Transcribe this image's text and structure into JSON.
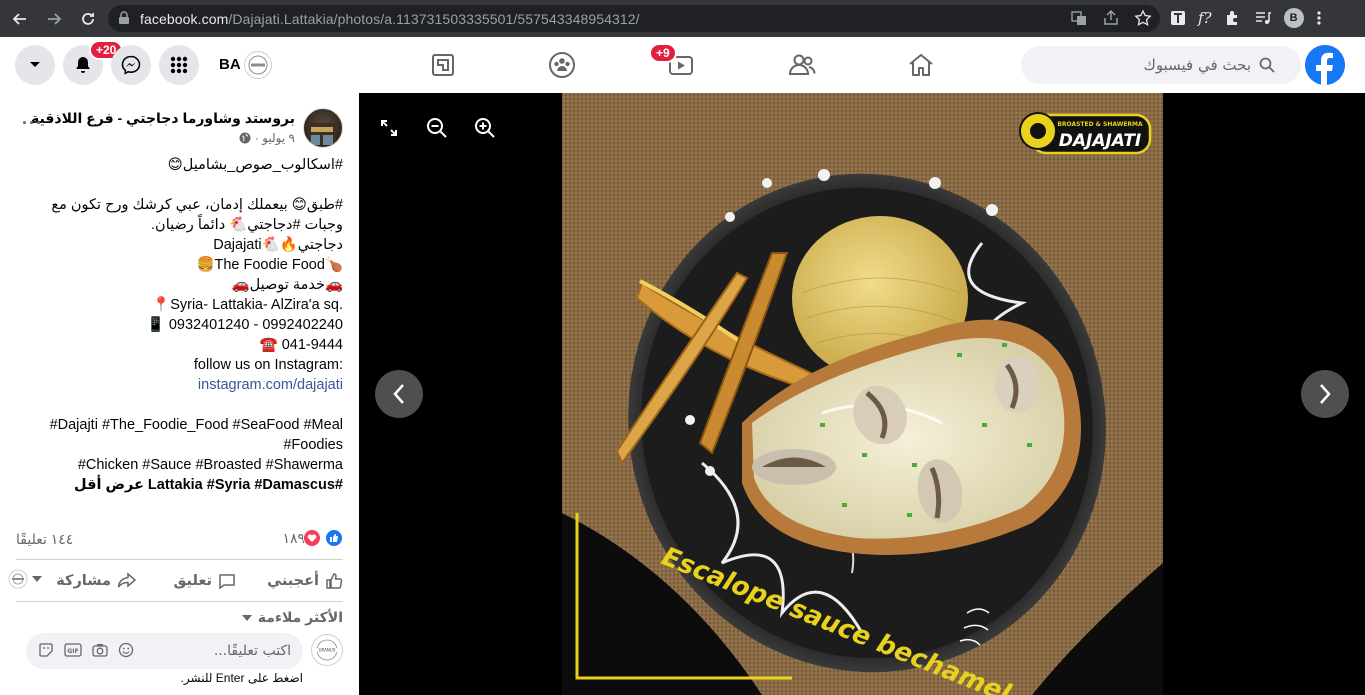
{
  "browser": {
    "url_host": "facebook.com",
    "url_path": "/Dajajati.Lattakia/photos/a.113731503335501/557543348954312/",
    "profile_initial": "B"
  },
  "fb": {
    "search_placeholder": "بحث في فيسبوك",
    "video_badge": "+9",
    "notif_badge": "+20",
    "account_label": "BA",
    "brand_color": "#1877f2"
  },
  "post": {
    "page_name": "بروستد وشاورما دجاجتي - فرع اللاذقية",
    "date": "٩ يوليو ·",
    "lines": [
      "#اسكالوب_صوص_بشاميل😊",
      "",
      "#طبق😊 بيعملك إدمان، عبي كرشك ورح تكون مع",
      "وجبات #دجاجتي🐔 دائماً رضيان.",
      "دجاجتي🔥🐔Dajajati",
      "🍗The Foodie Food🍔",
      "🚗خدمة توصيل🚗",
      "📍Syria- Lattakia- AlZira'a sq.",
      "📱 0932401240 - 0992402240",
      "☎️ 041-9444",
      "follow us on Instagram:",
      "instagram.com/dajajati",
      "",
      "#Dajajti #The_Foodie_Food #SeaFood #Meal",
      "#Foodies",
      "#Chicken #Sauce #Broasted #Shawerma",
      "#Lattakia #Syria #Damascus عرض أقل"
    ],
    "reactions_count": "١٨٩",
    "comments_count": "١٤٤ تعليقًا",
    "like_label": "أعجبني",
    "comment_label": "تعليق",
    "share_label": "مشاركة",
    "relevance_label": "الأكثر ملاءمة",
    "comment_placeholder": "اكتب تعليقًا...",
    "comment_hint": "اضغط على Enter للنشر.",
    "commenter_avatar_text": "URANUS"
  },
  "photo": {
    "logo_text": "DAJAJATI",
    "logo_sub": "BROASTED & SHAWERMA",
    "caption": "Escalope sauce bechamel"
  }
}
